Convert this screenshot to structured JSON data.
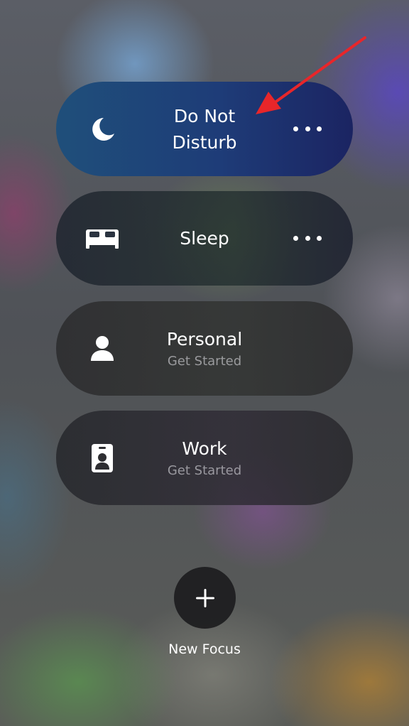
{
  "focus_modes": [
    {
      "id": "do-not-disturb",
      "title": "Do Not Disturb",
      "subtitle": "",
      "icon": "moon-icon",
      "active": true,
      "has_more": true
    },
    {
      "id": "sleep",
      "title": "Sleep",
      "subtitle": "",
      "icon": "bed-icon",
      "active": false,
      "has_more": true
    },
    {
      "id": "personal",
      "title": "Personal",
      "subtitle": "Get Started",
      "icon": "person-icon",
      "active": false,
      "has_more": false
    },
    {
      "id": "work",
      "title": "Work",
      "subtitle": "Get Started",
      "icon": "id-badge-icon",
      "active": false,
      "has_more": false
    }
  ],
  "new_focus": {
    "label": "New Focus",
    "icon": "plus-icon"
  },
  "annotation": {
    "icon": "red-arrow-icon",
    "color": "#e8262a"
  },
  "colors": {
    "active_pill": "#1e3c78",
    "inactive_pill": "#2c2c2e",
    "text_primary": "#ffffff",
    "text_secondary": "#8e8e93"
  }
}
